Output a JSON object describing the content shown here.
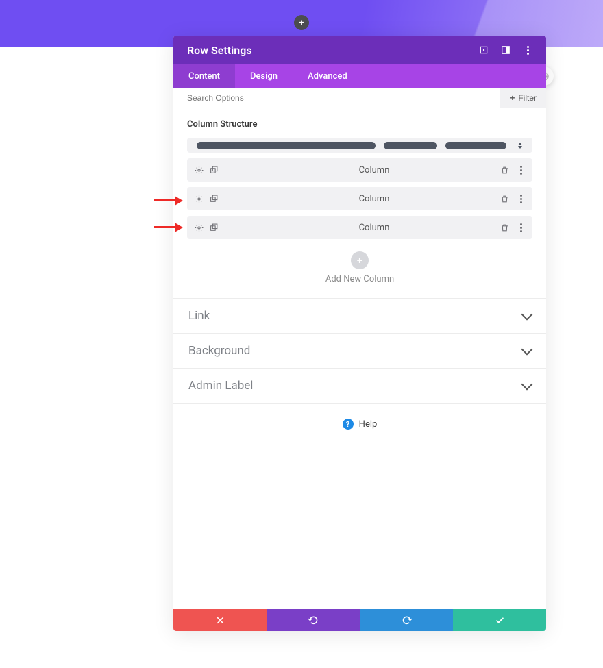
{
  "header": {
    "title": "Row Settings"
  },
  "tabs": [
    {
      "label": "Content",
      "active": true
    },
    {
      "label": "Design",
      "active": false
    },
    {
      "label": "Advanced",
      "active": false
    }
  ],
  "search": {
    "placeholder": "Search Options",
    "filter_label": "Filter"
  },
  "column_section": {
    "heading": "Column Structure",
    "items": [
      {
        "label": "Column"
      },
      {
        "label": "Column"
      },
      {
        "label": "Column"
      }
    ],
    "add_label": "Add New Column"
  },
  "accordions": [
    {
      "label": "Link"
    },
    {
      "label": "Background"
    },
    {
      "label": "Admin Label"
    }
  ],
  "help_label": "Help"
}
